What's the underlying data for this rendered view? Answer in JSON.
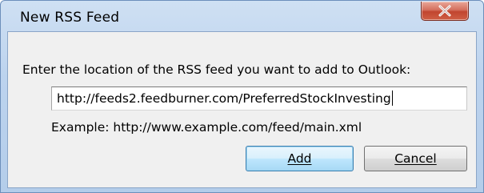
{
  "window": {
    "title": "New RSS Feed"
  },
  "dialog": {
    "prompt": "Enter the location of the RSS feed you want to add to Outlook:",
    "url_value": "http://feeds2.feedburner.com/PreferredStockInvesting",
    "example_text": "Example: http://www.example.com/feed/main.xml"
  },
  "buttons": {
    "add_label": "Add",
    "cancel_label": "Cancel"
  },
  "icons": {
    "close": "close-icon"
  },
  "colors": {
    "close_button": "#c1452f",
    "default_button_border": "#3c7fb1",
    "client_background": "#f0f0f0"
  }
}
